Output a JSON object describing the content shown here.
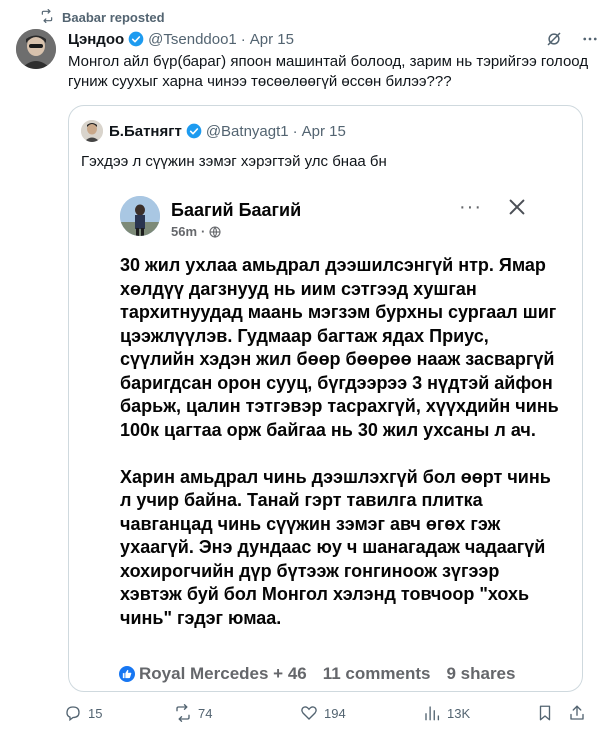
{
  "repost": {
    "label": "Baabar reposted"
  },
  "tweet": {
    "author_name": "Цэндоо",
    "handle": "@Tsenddoo1",
    "separator": "·",
    "date": "Apr 15",
    "text": "Монгол айл бүр(бараг) япоон машинтай болоод, зарим нь тэрийгээ голоод гуниж суухыг харна чинээ төсөөлөөгүй өссөн билээ???"
  },
  "quote": {
    "author_name": "Б.Батнягт",
    "handle": "@Batnyagt1",
    "separator": "·",
    "date": "Apr 15",
    "text": "Гэхдээ л сүүжин зэмэг хэрэгтэй улс бнаа бн",
    "embedded_post": {
      "author_name": "Баагий Баагий",
      "time": "56m",
      "more_label": "···",
      "paragraph_1": "30 жил ухлаа амьдрал дээшилсэнгүй нтр. Ямар хөлдүү дагзнууд нь иим сэтгээд хушган тархитнуудад маань мэгзэм бурхны сургаал шиг цээжлүүлэв. Гудмаар багтаж ядах Приус, сүүлийн хэдэн жил бөөр бөөрөө нааж засваргүй баригдсан орон сууц, бүгдээрээ 3 нүдтэй айфон барьж, цалин тэтгэвэр тасрахгүй, хүүхдийн чинь 100к цагтаа орж байгаа нь 30 жил ухсаны л ач.",
      "paragraph_2": "Харин амьдрал чинь дээшлэхгүй бол өөрт чинь л учир байна. Танай гэрт тавилга плитка чавганцад чинь сүүжин зэмэг авч өгөх гэж ухаагүй. Энэ дундаас юу ч шанагадаж чадаагүй хохирогчийн дүр бүтээж гонгиноож зүгээр хэвтэж буй бол Монгол хэлэнд товчоор \"хохь чинь\" гэдэг юмаа.",
      "reactions": "Royal Mercedes + 46",
      "comments": "11 comments",
      "shares": "9 shares"
    }
  },
  "actions": {
    "replies": "15",
    "reposts": "74",
    "likes": "194",
    "views": "13K"
  },
  "colors": {
    "text_primary": "#0f1419",
    "text_secondary": "#536471",
    "verified_blue": "#1d9bf0",
    "repost_green": "#00ba7c",
    "fb_blue": "#1877f2",
    "border": "#cfd9de"
  }
}
